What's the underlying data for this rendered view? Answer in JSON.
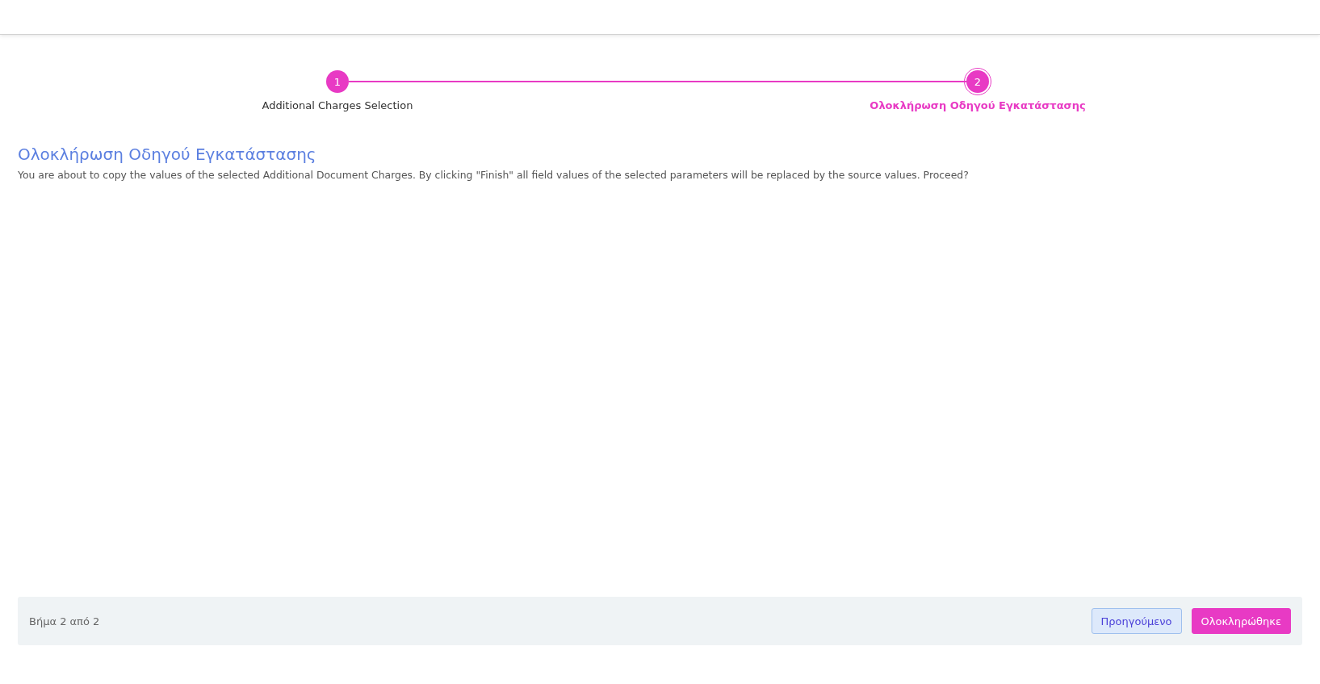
{
  "steps": [
    {
      "number": "1",
      "label": "Additional Charges Selection",
      "selected": false
    },
    {
      "number": "2",
      "label": "Ολοκλήρωση Οδηγού Εγκατάστασης",
      "selected": true
    }
  ],
  "heading": "Ολοκλήρωση Οδηγού Εγκατάστασης",
  "message": "You are about to copy the values of the selected Additional Document Charges. By clicking \"Finish\" all field values of the selected parameters will be replaced by the source values. Proceed?",
  "footer": {
    "step_text": "Βήμα 2 από 2",
    "buttons": [
      {
        "label": "Προηγούμενο",
        "kind": "secondary"
      },
      {
        "label": "Ολοκληρώθηκε",
        "kind": "primary"
      }
    ]
  }
}
